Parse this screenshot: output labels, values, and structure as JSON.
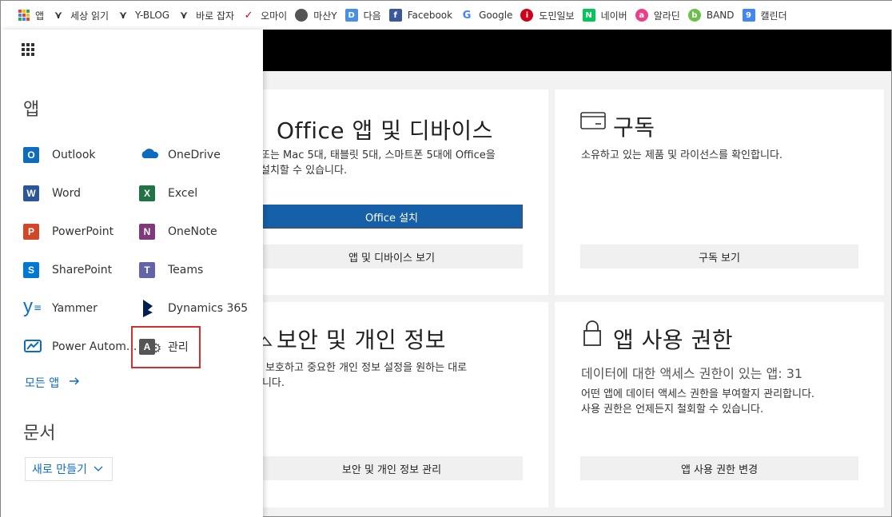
{
  "bookmarks": [
    {
      "label": "앱",
      "icon": "apps-grid-icon",
      "color": "#4285f4"
    },
    {
      "label": "세상 읽기",
      "icon": "tistory-icon",
      "color": "#333333"
    },
    {
      "label": "Y-BLOG",
      "icon": "tistory-icon",
      "color": "#333333"
    },
    {
      "label": "바로 잡자",
      "icon": "tistory-icon",
      "color": "#333333"
    },
    {
      "label": "오마이",
      "icon": "ohmy-icon",
      "color": "#d0021b"
    },
    {
      "label": "마산Y",
      "icon": "globe-icon",
      "color": "#555555"
    },
    {
      "label": "다음",
      "icon": "daum-icon",
      "color": "#4a90e2"
    },
    {
      "label": "Facebook",
      "icon": "facebook-icon",
      "color": "#3b5998"
    },
    {
      "label": "Google",
      "icon": "google-icon",
      "color": "#4285f4"
    },
    {
      "label": "도민일보",
      "icon": "info-icon",
      "color": "#d0021b"
    },
    {
      "label": "네이버",
      "icon": "naver-icon",
      "color": "#03c75a"
    },
    {
      "label": "알라딘",
      "icon": "aladin-icon",
      "color": "#e8418a"
    },
    {
      "label": "BAND",
      "icon": "band-icon",
      "color": "#6bc04b"
    },
    {
      "label": "캘린더",
      "icon": "calendar-icon",
      "color": "#4285f4"
    }
  ],
  "panel": {
    "apps_heading": "앱",
    "apps": [
      {
        "label": "Outlook",
        "letter": "O",
        "color": "#0f6cbd",
        "icon": "outlook-icon"
      },
      {
        "label": "OneDrive",
        "letter": "",
        "color": "#0f6cbd",
        "icon": "onedrive-icon"
      },
      {
        "label": "Word",
        "letter": "W",
        "color": "#2b579a",
        "icon": "word-icon"
      },
      {
        "label": "Excel",
        "letter": "X",
        "color": "#217346",
        "icon": "excel-icon"
      },
      {
        "label": "PowerPoint",
        "letter": "P",
        "color": "#d24726",
        "icon": "powerpoint-icon"
      },
      {
        "label": "OneNote",
        "letter": "N",
        "color": "#80397b",
        "icon": "onenote-icon"
      },
      {
        "label": "SharePoint",
        "letter": "S",
        "color": "#0078d4",
        "icon": "sharepoint-icon"
      },
      {
        "label": "Teams",
        "letter": "T",
        "color": "#6264a7",
        "icon": "teams-icon"
      },
      {
        "label": "Yammer",
        "letter": "y",
        "color": "#106ebe",
        "icon": "yammer-icon"
      },
      {
        "label": "Dynamics 365",
        "letter": "",
        "color": "#002050",
        "icon": "dynamics-icon"
      },
      {
        "label": "Power Autom...",
        "letter": "",
        "color": "#0f6cbd",
        "icon": "power-automate-icon"
      },
      {
        "label": "관리",
        "letter": "A",
        "color": "#555555",
        "icon": "admin-icon"
      }
    ],
    "all_apps": "모든 앱",
    "docs_heading": "문서",
    "new_button": "새로 만들기"
  },
  "cards": {
    "office": {
      "title": "Office 앱 및 디바이스",
      "desc_line1": "또는 Mac 5대, 태블릿 5대, 스마트폰 5대에 Office을",
      "desc_line2": "설치할 수 있습니다.",
      "primary_button": "Office 설치",
      "secondary_button": "앱 및 디바이스 보기"
    },
    "subscription": {
      "title": "구독",
      "desc": "소유하고 있는 제품 및 라이선스를 확인합니다.",
      "button": "구독 보기"
    },
    "security": {
      "title": "보안 및 개인 정보",
      "desc_line1": "를 보호하고 중요한 개인 정보 설정을 원하는 대로",
      "desc_line2": "합니다.",
      "button": "보안 및 개인 정보 관리"
    },
    "permissions": {
      "title": "앱 사용 권한",
      "subtitle": "데이터에 대한 액세스 권한이 있는 앱: 31",
      "desc_line1": "어떤 앱에 데이터 액세스 권한을 부여할지 관리합니다.",
      "desc_line2": "사용 권한은 언제든지 철회할 수 있습니다.",
      "button": "앱 사용 권한 변경"
    }
  },
  "colors": {
    "accent": "#1560a8",
    "link": "#0f6cbd",
    "highlight": "#d32f2f"
  }
}
